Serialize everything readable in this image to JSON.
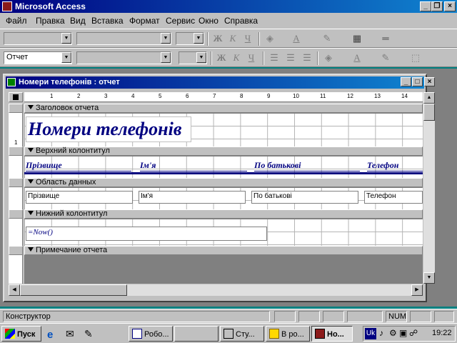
{
  "app": {
    "title": "Microsoft Access",
    "btn_min": "_",
    "btn_restore": "❐",
    "btn_close": "×"
  },
  "menu": [
    "Файл",
    "Правка",
    "Вид",
    "Вставка",
    "Формат",
    "Сервис",
    "Окно",
    "Справка"
  ],
  "toolbar1": {
    "bold": "Ж",
    "italic": "К",
    "underline": "Ч"
  },
  "toolbar2": {
    "object_combo": "Отчет",
    "bold": "Ж",
    "italic": "К",
    "underline": "Ч"
  },
  "report_window": {
    "title": "Номери телефонів : отчет",
    "ruler_marks": [
      "1",
      "2",
      "3",
      "4",
      "5",
      "6",
      "7",
      "8",
      "9",
      "10",
      "11",
      "12",
      "13",
      "14"
    ],
    "vruler_mark": "1",
    "bands": {
      "report_header": "Заголовок отчета",
      "page_header": "Верхний колонтитул",
      "detail": "Область данных",
      "page_footer": "Нижний колонтитул",
      "report_footer": "Примечание отчета"
    },
    "report_title": "Номери телефонів",
    "header_labels": [
      "Прізвище",
      "Ім'я",
      "По батькові",
      "Телефон"
    ],
    "detail_fields": [
      "Прізвище",
      "Ім'я",
      "По батькові",
      "Телефон"
    ],
    "footer_expr": "=Now()"
  },
  "status": {
    "mode": "Конструктор",
    "num": "NUM"
  },
  "taskbar": {
    "start": "Пуск",
    "items": [
      "Робо...",
      "",
      "Сту...",
      "В ро...",
      "Но..."
    ],
    "lang": "Uk",
    "clock": "19:22"
  }
}
